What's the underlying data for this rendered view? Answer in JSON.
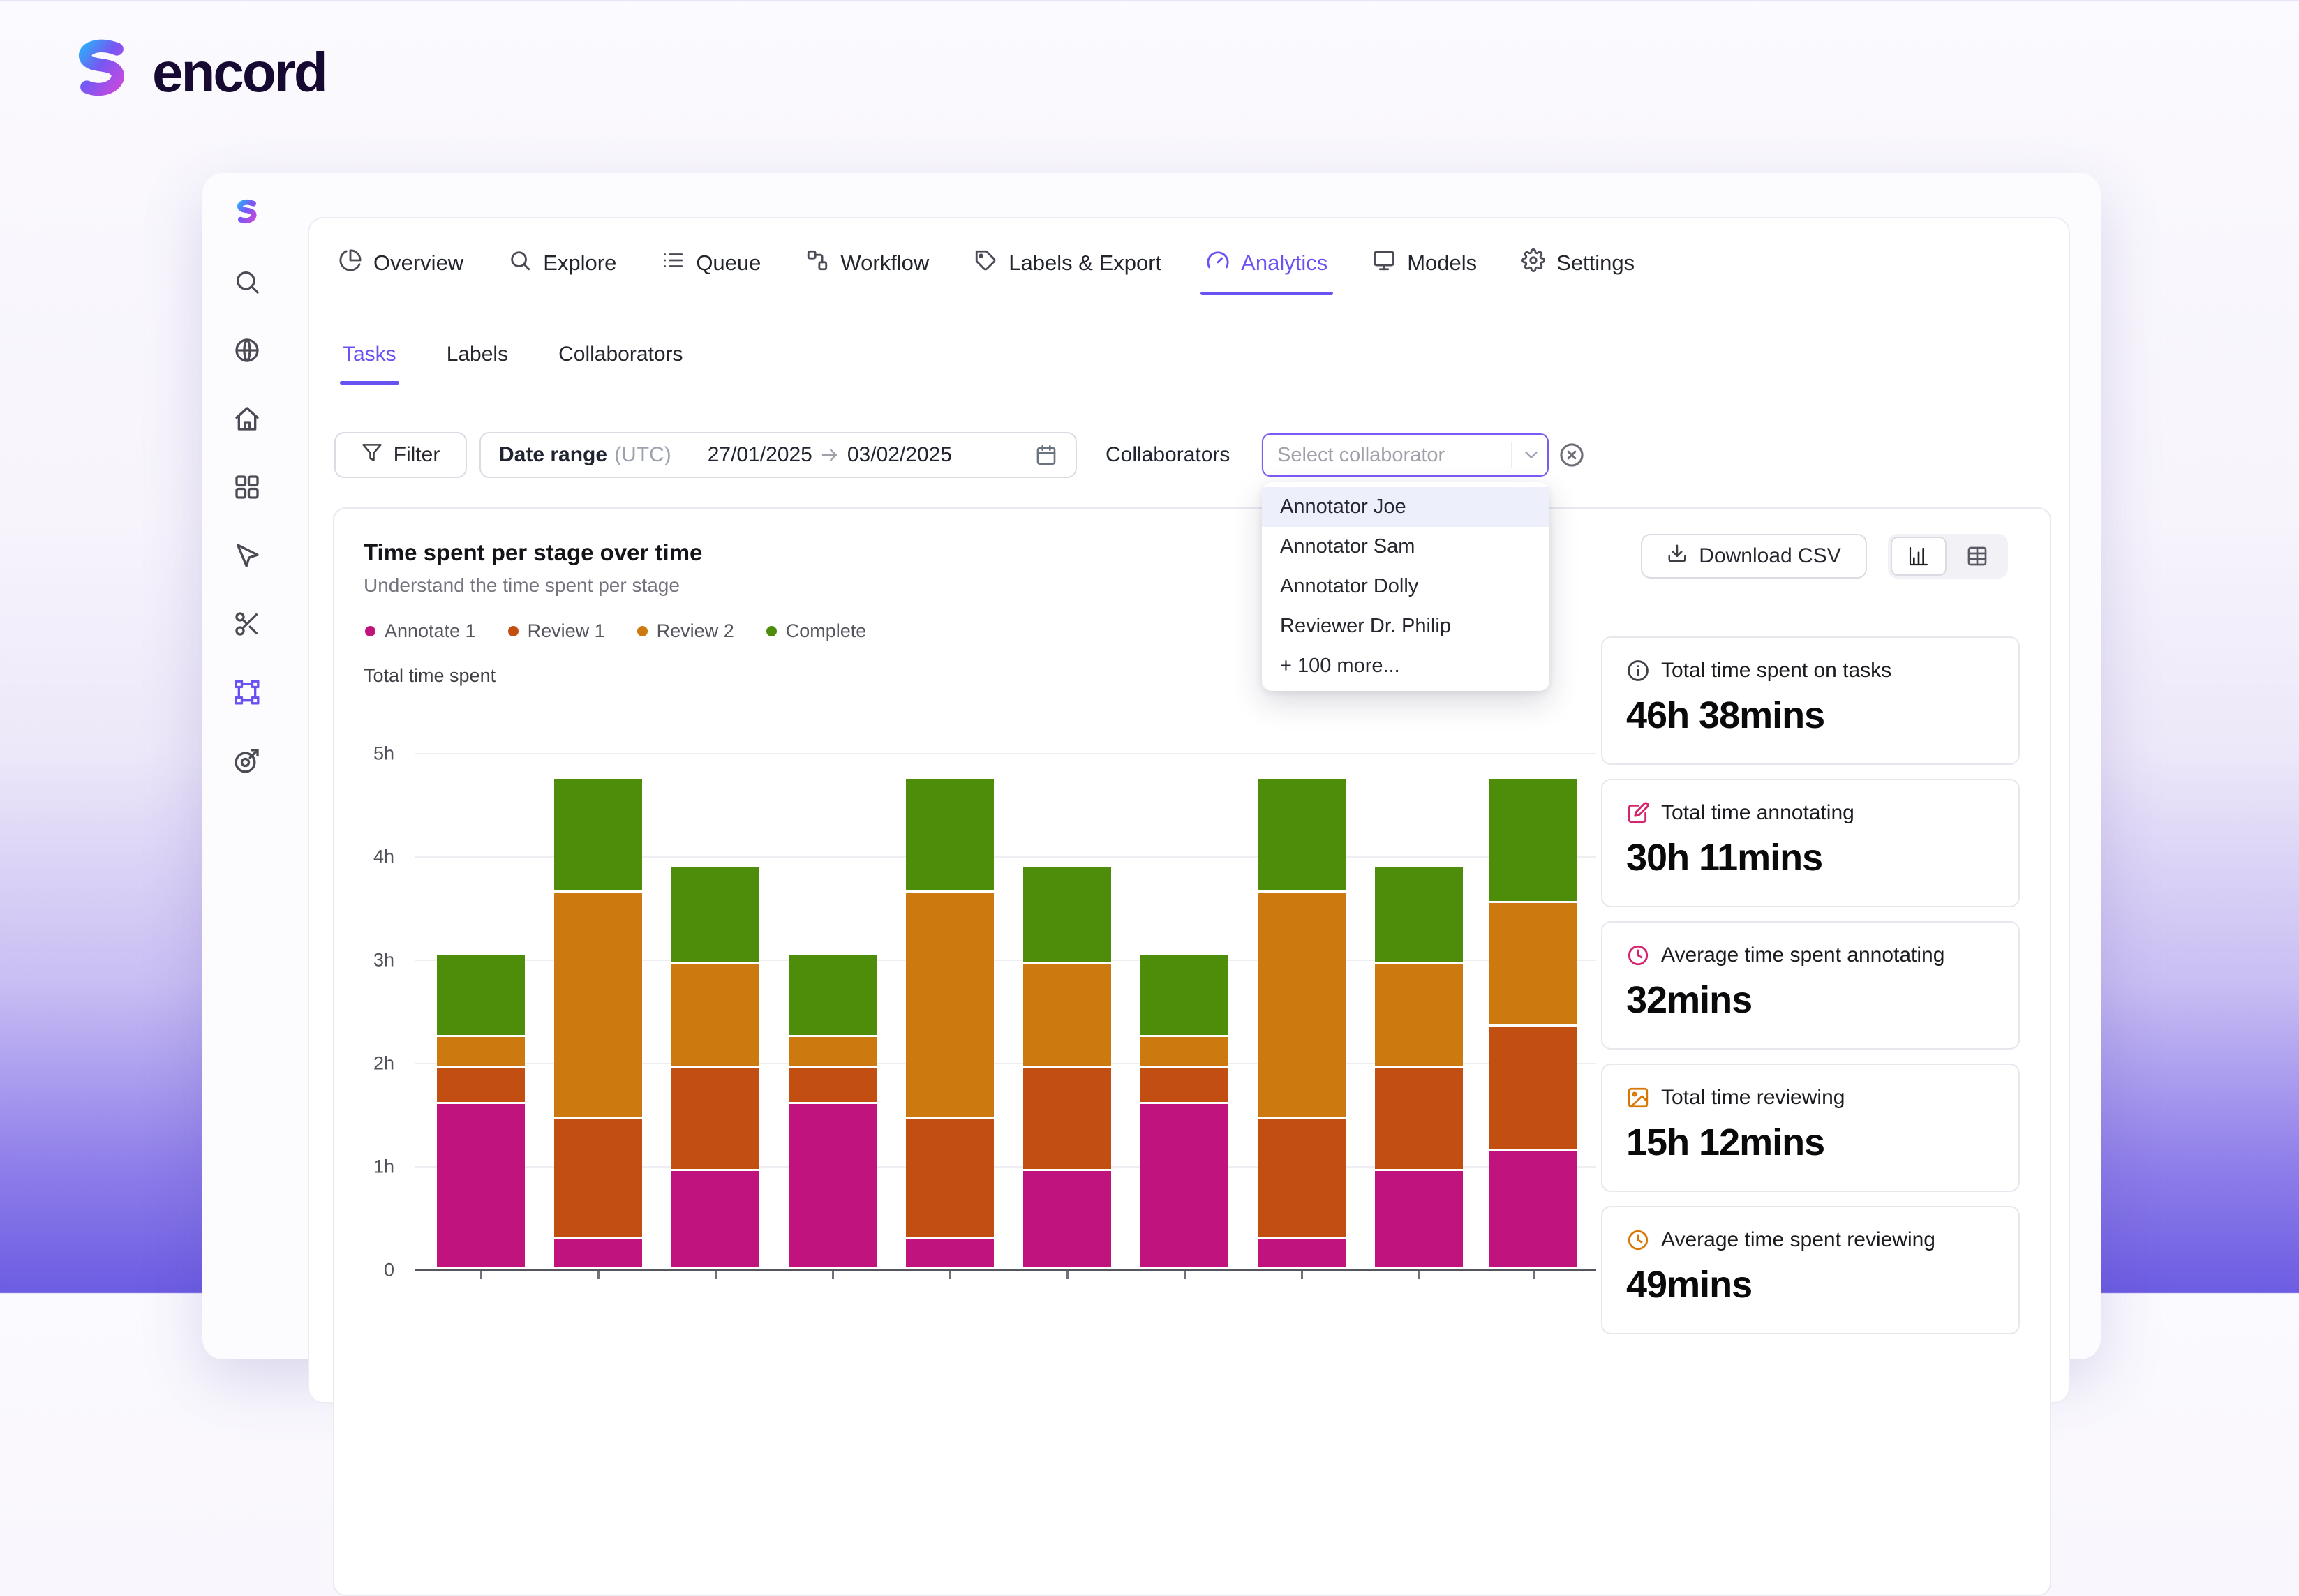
{
  "brand": {
    "wordmark": "encord",
    "logo_icon": "encord-logo-icon"
  },
  "sidebar": {
    "items": [
      {
        "name": "sidebar-logo",
        "icon": "encord-logo-icon"
      },
      {
        "name": "sidebar-search",
        "icon": "search-icon"
      },
      {
        "name": "sidebar-globe",
        "icon": "globe-icon"
      },
      {
        "name": "sidebar-home",
        "icon": "home-icon"
      },
      {
        "name": "sidebar-apps",
        "icon": "apps-grid-icon"
      },
      {
        "name": "sidebar-select-tool",
        "icon": "cursor-select-icon"
      },
      {
        "name": "sidebar-scissors",
        "icon": "scissors-icon"
      },
      {
        "name": "sidebar-annotate",
        "icon": "vector-square-icon",
        "active": true
      },
      {
        "name": "sidebar-target",
        "icon": "dart-target-icon"
      }
    ]
  },
  "nav": {
    "items": [
      {
        "label": "Overview",
        "icon": "pie-chart-icon"
      },
      {
        "label": "Explore",
        "icon": "search-icon"
      },
      {
        "label": "Queue",
        "icon": "list-icon"
      },
      {
        "label": "Workflow",
        "icon": "workflow-icon"
      },
      {
        "label": "Labels & Export",
        "icon": "tag-icon"
      },
      {
        "label": "Analytics",
        "icon": "gauge-icon",
        "active": true
      },
      {
        "label": "Models",
        "icon": "monitor-icon"
      },
      {
        "label": "Settings",
        "icon": "gear-icon"
      }
    ]
  },
  "subtabs": {
    "items": [
      {
        "label": "Tasks",
        "active": true
      },
      {
        "label": "Labels"
      },
      {
        "label": "Collaborators"
      }
    ]
  },
  "filters": {
    "filter_label": "Filter",
    "filter_icon": "funnel-icon",
    "date_range": {
      "label": "Date range",
      "suffix": "(UTC)",
      "start": "27/01/2025",
      "end": "03/02/2025",
      "arrow_icon": "arrow-right-icon",
      "calendar_icon": "calendar-icon"
    },
    "collaborators_label": "Collaborators",
    "select": {
      "placeholder": "Select collaborator",
      "chevron_icon": "chevron-down-icon",
      "clear_icon": "x-circle-icon",
      "focused": true
    },
    "dropdown": {
      "options": [
        "Annotator Joe",
        "Annotator Sam",
        "Annotator Dolly",
        "Reviewer Dr. Philip",
        "+ 100 more..."
      ],
      "highlighted_index": 0
    }
  },
  "chart": {
    "title": "Time spent per stage over time",
    "subtitle": "Understand the time spent per stage",
    "y_axis_title": "Total time spent",
    "download_label": "Download CSV",
    "download_icon": "download-icon",
    "view_toggle": {
      "options": [
        "chart",
        "table"
      ],
      "icons": [
        "bar-chart-icon",
        "table-icon"
      ],
      "active": "chart"
    }
  },
  "chart_data": {
    "type": "bar",
    "stacked": true,
    "title": "Time spent per stage over time",
    "ylabel": "Total time spent",
    "y_ticks": [
      "0",
      "1h",
      "2h",
      "3h",
      "4h",
      "5h"
    ],
    "ylim_hours": [
      0,
      5
    ],
    "grid": true,
    "legend_position": "top-left",
    "x_labels_visible": false,
    "series": [
      {
        "name": "Annotate 1",
        "color": "#C1137E",
        "values": [
          1.6,
          0.3,
          0.95,
          1.6,
          0.3,
          0.95,
          1.6,
          0.3,
          0.95,
          1.15
        ]
      },
      {
        "name": "Review 1",
        "color": "#C24E12",
        "values": [
          0.35,
          1.15,
          1.0,
          0.35,
          1.15,
          1.0,
          0.35,
          1.15,
          1.0,
          1.2
        ]
      },
      {
        "name": "Review 2",
        "color": "#CC7A10",
        "values": [
          0.3,
          2.2,
          1.0,
          0.3,
          2.2,
          1.0,
          0.3,
          2.2,
          1.0,
          1.2
        ]
      },
      {
        "name": "Complete",
        "color": "#4E8D0A",
        "values": [
          0.8,
          1.1,
          0.95,
          0.8,
          1.1,
          0.95,
          0.8,
          1.1,
          0.95,
          1.2
        ]
      }
    ]
  },
  "stats": [
    {
      "icon": "info-icon",
      "icon_color": "#3F3F46",
      "label": "Total time spent on tasks",
      "value": "46h 38mins"
    },
    {
      "icon": "edit-icon",
      "icon_color": "#D6246E",
      "label": "Total time annotating",
      "value": "30h 11mins"
    },
    {
      "icon": "clock-icon",
      "icon_color": "#D6246E",
      "label": "Average time spent annotating",
      "value": "32mins"
    },
    {
      "icon": "image-icon",
      "icon_color": "#D97706",
      "label": "Total time reviewing",
      "value": "15h 12mins"
    },
    {
      "icon": "clock-icon",
      "icon_color": "#D97706",
      "label": "Average time spent reviewing",
      "value": "49mins"
    }
  ]
}
